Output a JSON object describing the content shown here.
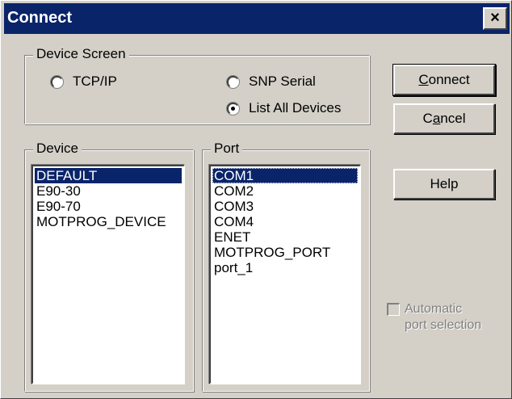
{
  "window": {
    "title": "Connect",
    "close_glyph": "×",
    "close_icon": "close-icon"
  },
  "device_screen": {
    "label": "Device Screen",
    "options": [
      {
        "label": "TCP/IP",
        "checked": false
      },
      {
        "label": "SNP Serial",
        "checked": false
      },
      {
        "label": "List All Devices",
        "checked": true
      }
    ]
  },
  "device": {
    "label": "Device",
    "items": [
      "DEFAULT",
      "E90-30",
      "E90-70",
      "MOTPROG_DEVICE"
    ],
    "selected_index": 0
  },
  "port": {
    "label": "Port",
    "items": [
      "COM1",
      "COM2",
      "COM3",
      "COM4",
      "ENET",
      "MOTPROG_PORT",
      "port_1"
    ],
    "selected_index": 0
  },
  "buttons": {
    "connect_pre": "",
    "connect_mnemonic": "C",
    "connect_post": "onnect",
    "cancel_pre": "C",
    "cancel_mnemonic": "a",
    "cancel_post": "ncel",
    "help": "Help"
  },
  "auto_port": {
    "line1": "Automatic",
    "line2": "port selection",
    "checked": false,
    "enabled": false
  },
  "colors": {
    "face": "#d4d0c8",
    "title_bar": "#0a246a",
    "selection": "#0a246a",
    "disabled_text": "#808080"
  }
}
